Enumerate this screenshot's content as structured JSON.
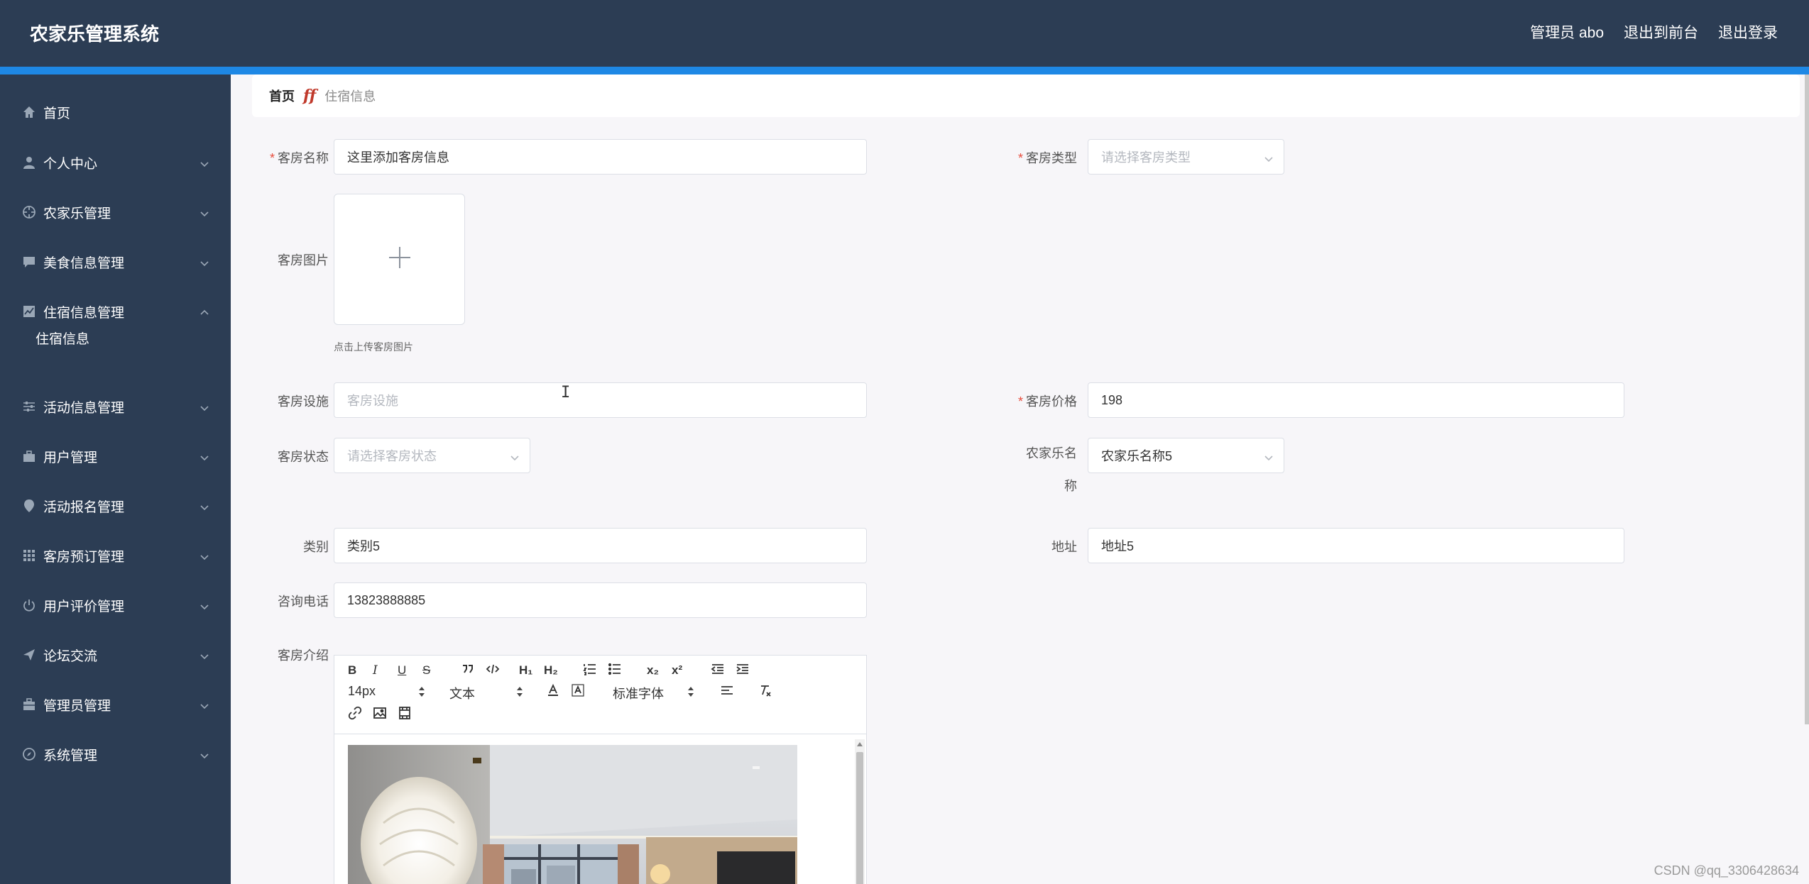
{
  "app": {
    "title": "农家乐管理系统"
  },
  "header": {
    "links": [
      "管理员 abo",
      "退出到前台",
      "退出登录"
    ]
  },
  "sidebar": {
    "items": [
      {
        "label": "首页",
        "icon": "home-icon"
      },
      {
        "label": "个人中心",
        "icon": "user-icon"
      },
      {
        "label": "农家乐管理",
        "icon": "crosshair-icon"
      },
      {
        "label": "美食信息管理",
        "icon": "chat-icon"
      },
      {
        "label": "住宿信息管理",
        "icon": "chart-icon",
        "expanded": true
      },
      {
        "label": "活动信息管理",
        "icon": "sliders-icon"
      },
      {
        "label": "用户管理",
        "icon": "briefcase-icon"
      },
      {
        "label": "活动报名管理",
        "icon": "location-icon"
      },
      {
        "label": "客房预订管理",
        "icon": "grid-icon"
      },
      {
        "label": "用户评价管理",
        "icon": "power-icon"
      },
      {
        "label": "论坛交流",
        "icon": "send-icon"
      },
      {
        "label": "管理员管理",
        "icon": "suitcase-icon"
      },
      {
        "label": "系统管理",
        "icon": "compass-icon"
      }
    ],
    "sub_items": [
      "住宿信息"
    ]
  },
  "breadcrumb": {
    "home": "首页",
    "separator": "ff",
    "current": "住宿信息"
  },
  "form": {
    "room_name": {
      "label": "客房名称",
      "required": true,
      "value": "这里添加客房信息"
    },
    "room_type": {
      "label": "客房类型",
      "required": true,
      "placeholder": "请选择客房类型"
    },
    "room_image": {
      "label": "客房图片",
      "hint": "点击上传客房图片"
    },
    "facilities": {
      "label": "客房设施",
      "placeholder": "客房设施"
    },
    "price": {
      "label": "客房价格",
      "required": true,
      "value": "198"
    },
    "status": {
      "label": "客房状态",
      "placeholder": "请选择客房状态"
    },
    "farm_name": {
      "label_line1": "农家乐名",
      "label_line2": "称",
      "value": "农家乐名称5"
    },
    "category": {
      "label": "类别",
      "value": "类别5"
    },
    "address": {
      "label": "地址",
      "value": "地址5"
    },
    "phone": {
      "label": "咨询电话",
      "value": "13823888885"
    },
    "intro": {
      "label": "客房介绍"
    }
  },
  "editor": {
    "font_size": "14px",
    "block_format": "文本",
    "font_family": "标准字体",
    "buttons": [
      "B",
      "I",
      "U",
      "S"
    ],
    "h1": "H₁",
    "h2": "H₂",
    "sub": "x₂",
    "sup": "x²"
  },
  "watermark": "CSDN @qq_3306428634",
  "colors": {
    "header_bg": "#2c3d54",
    "accent_stripe": "#1e88e5",
    "required": "#e74c3c"
  }
}
